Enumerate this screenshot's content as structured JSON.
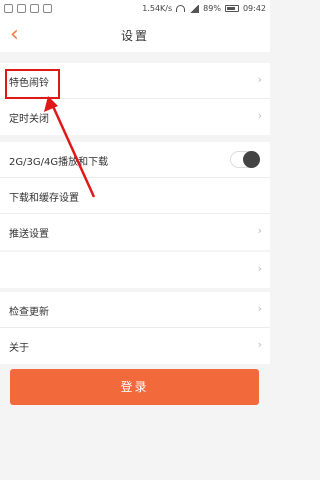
{
  "status_bar": {
    "network_speed": "1.54K/s",
    "battery": "89%",
    "time": "09:42"
  },
  "header": {
    "title": "设置"
  },
  "group1": {
    "items": [
      {
        "label": "特色闹铃"
      },
      {
        "label": "定时关闭"
      }
    ]
  },
  "group2": {
    "items": [
      {
        "label": "2G/3G/4G播放和下载",
        "toggle": "off"
      },
      {
        "label": "下载和缓存设置"
      },
      {
        "label": "推送设置"
      }
    ]
  },
  "group3": {
    "items": [
      {
        "label": ""
      }
    ]
  },
  "group4": {
    "items": [
      {
        "label": "检查更新"
      },
      {
        "label": "关于"
      }
    ]
  },
  "login_button": {
    "label": "登录"
  },
  "colors": {
    "accent": "#f26a3c",
    "annotation": "#e01818"
  }
}
